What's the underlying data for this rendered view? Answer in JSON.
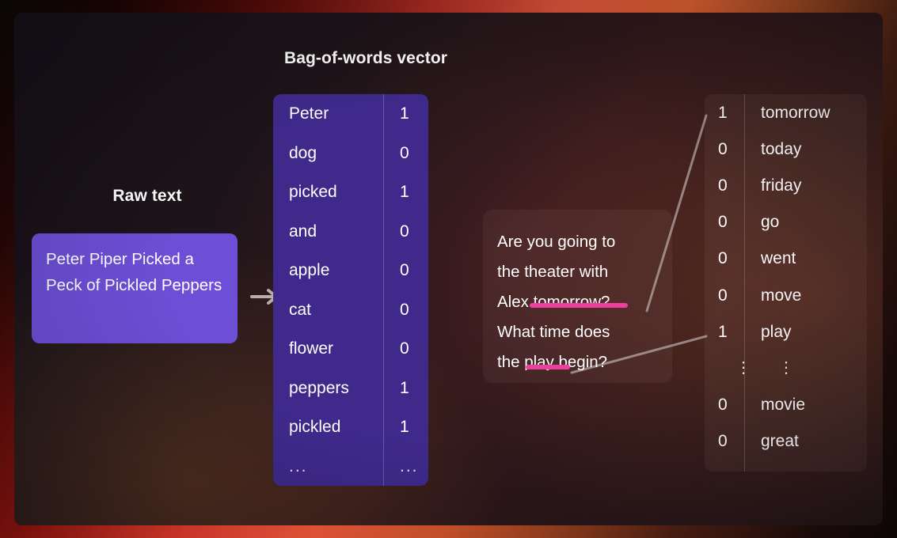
{
  "slide": {
    "bow_title": "Bag-of-words vector",
    "raw_title": "Raw text",
    "raw_text": "Peter Piper Picked a Peck of Pickled Peppers",
    "arrow_icon": "arrow-right-icon"
  },
  "bow_table": {
    "rows": [
      {
        "word": "Peter",
        "value": "1"
      },
      {
        "word": "dog",
        "value": "0"
      },
      {
        "word": "picked",
        "value": "1"
      },
      {
        "word": "and",
        "value": "0"
      },
      {
        "word": "apple",
        "value": "0"
      },
      {
        "word": "cat",
        "value": "0"
      },
      {
        "word": "flower",
        "value": "0"
      },
      {
        "word": "peppers",
        "value": "1"
      },
      {
        "word": "pickled",
        "value": "1"
      },
      {
        "word": "...",
        "value": "..."
      }
    ]
  },
  "question_card": {
    "lines": [
      "Are you going to",
      "the theater with",
      "Alex tomorrow?",
      "What time does",
      "the play begin?"
    ],
    "highlights": [
      "tomorrow",
      "play"
    ],
    "highlight_color": "#ec3f9e"
  },
  "vocab_table": {
    "rows": [
      {
        "value": "1",
        "word": "tomorrow"
      },
      {
        "value": "0",
        "word": "today"
      },
      {
        "value": "0",
        "word": "friday"
      },
      {
        "value": "0",
        "word": "go"
      },
      {
        "value": "0",
        "word": "went"
      },
      {
        "value": "0",
        "word": "move"
      },
      {
        "value": "1",
        "word": "play"
      },
      {
        "value": "⋮",
        "word": "⋮"
      },
      {
        "value": "0",
        "word": "movie"
      },
      {
        "value": "0",
        "word": "great"
      }
    ]
  },
  "colors": {
    "raw_card": "#6c4fd6",
    "bow_table": "#3f2a8c",
    "highlight": "#ec3f9e",
    "connector": "#9b8b88",
    "text": "#ffffff"
  }
}
